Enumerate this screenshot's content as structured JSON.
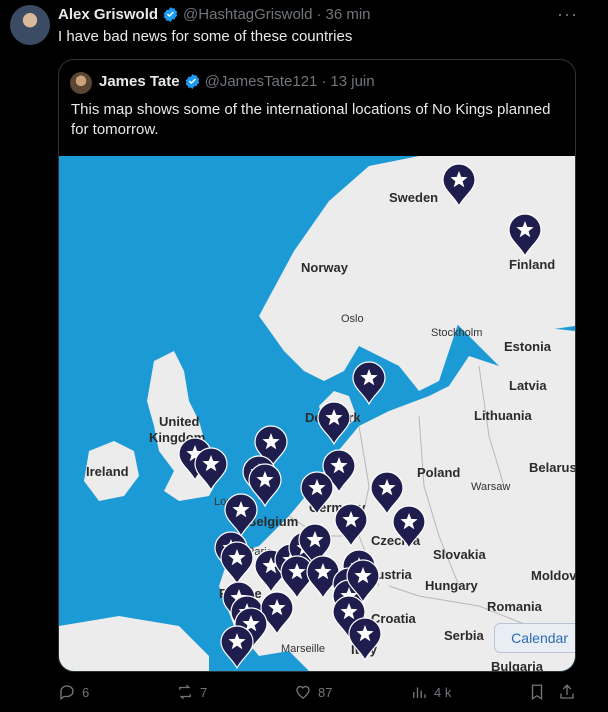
{
  "post": {
    "author_name": "Alex Griswold",
    "author_handle": "@HashtagGriswold",
    "time": "36 min",
    "separator": "·",
    "text": "I have bad news for some of these countries",
    "more_label": "···"
  },
  "quote": {
    "author_name": "James Tate",
    "author_handle": "@JamesTate121",
    "date": "13 juin",
    "separator": "·",
    "text": "This map shows some of the international locations of No Kings planned for tomorrow."
  },
  "map": {
    "labels": {
      "sweden": "Sweden",
      "finland": "Finland",
      "norway": "Norway",
      "oslo": "Oslo",
      "stockholm": "Stockholm",
      "estonia": "Estonia",
      "latvia": "Latvia",
      "lithuania": "Lithuania",
      "united_kingdom_1": "United",
      "united_kingdom_2": "Kingdom",
      "denmark": "Denmark",
      "ireland": "Ireland",
      "poland": "Poland",
      "belarus": "Belarus",
      "warsaw": "Warsaw",
      "london": "London",
      "germany": "Germany",
      "belgium": "Belgium",
      "paris": "Paris",
      "czechia": "Czechia",
      "slovakia": "Slovakia",
      "austria": "Austria",
      "moldova": "Moldova",
      "hungary": "Hungary",
      "france": "France",
      "romania": "Romania",
      "croatia": "Croatia",
      "serbia": "Serbia",
      "marseille": "Marseille",
      "italy": "Italy",
      "bulgaria": "Bulgaria"
    },
    "calendar_button": "Calendar",
    "pin_color": "#1f1d4d",
    "water_color": "#1b9ad6",
    "land_color": "#ececec"
  },
  "actions": {
    "replies": "6",
    "reposts": "7",
    "likes": "87",
    "views": "4 k"
  }
}
